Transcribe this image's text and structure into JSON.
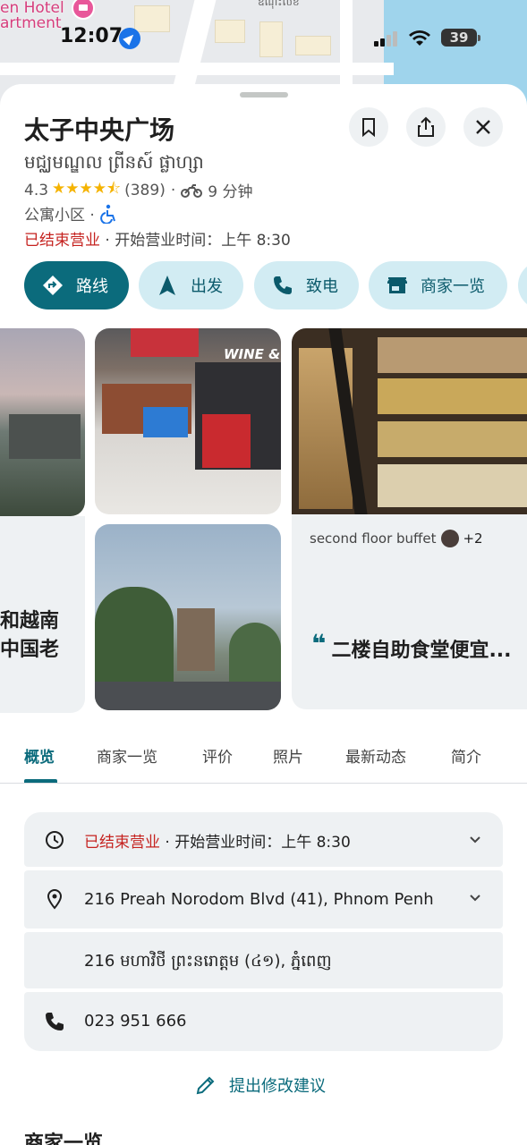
{
  "map": {
    "hotel_label_line1": "en Hotel",
    "hotel_label_line2": "artment",
    "khmer_label": "ឌំណុះលិខ"
  },
  "status_bar": {
    "time": "12:07",
    "battery": "39"
  },
  "place": {
    "title": "太子中央广场",
    "subtitle": "មជ្ឈមណ្ឌល ព្រីនស៍ ផ្លាហ្សា",
    "rating": "4.3",
    "stars": "★★★★⯪",
    "review_count": "(389)",
    "sep": "·",
    "travel_time": "9 分钟",
    "type": "公寓小区 ·",
    "status_closed": "已结束营业",
    "status_hours": " · 开始营业时间：上午 8:30"
  },
  "chips": {
    "route": "路线",
    "start": "出发",
    "call": "致电",
    "directory": "商家一览"
  },
  "photos": {
    "left_text": "和越南\n中国老",
    "review_label": "second floor buffet",
    "review_plus": "+2",
    "review_quote": "二楼自助食堂便宜...",
    "store_sign": "WINE &"
  },
  "tabs": [
    "概览",
    "商家一览",
    "评价",
    "照片",
    "最新动态",
    "简介"
  ],
  "info": {
    "hours_closed": "已结束营业",
    "hours_rest": " · 开始营业时间：上午 8:30",
    "address": "216 Preah Norodom Blvd (41), Phnom Penh",
    "address_khmer": "216 មហាវិថី ព្រះនរោត្តម (៤១), ភ្នំពេញ",
    "phone": "023 951 666"
  },
  "suggest_edit": "提出修改建议",
  "section_title": "商家一览",
  "colors": {
    "accent": "#0b6b7c",
    "chip_bg": "#d2ecf3",
    "closed_red": "#c5221f",
    "star": "#f5b301"
  }
}
